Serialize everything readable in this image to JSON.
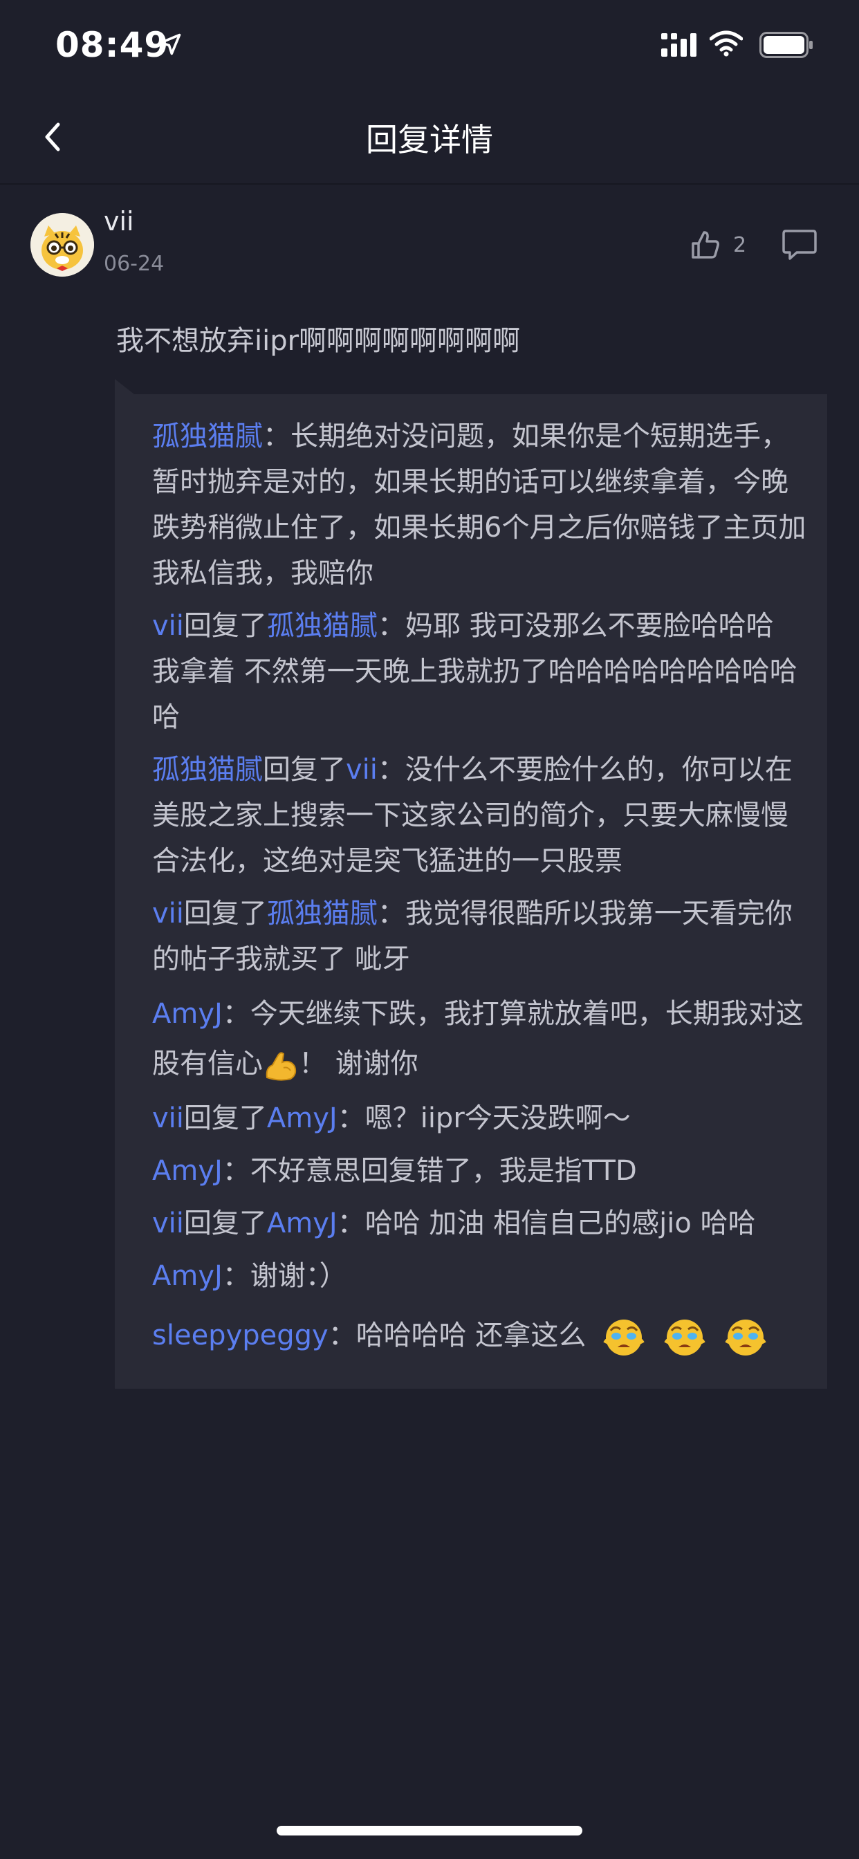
{
  "status_bar": {
    "time": "08:49"
  },
  "nav": {
    "title": "回复详情"
  },
  "comment": {
    "username": "vii",
    "date": "06-24",
    "like_count": "2",
    "text": "我不想放弃iipr啊啊啊啊啊啊啊啊"
  },
  "replies": [
    {
      "user": "孤独猫腻",
      "reply_word": "",
      "target": "",
      "sep": "：",
      "text": "长期绝对没问题，如果你是个短期选手，暂时抛弃是对的，如果长期的话可以继续拿着，今晚跌势稍微止住了，如果长期6个月之后你赔钱了主页加我私信我，我赔你"
    },
    {
      "user": "vii",
      "reply_word": "回复了",
      "target": "孤独猫腻",
      "sep": "：",
      "text": "妈耶 我可没那么不要脸哈哈哈 我拿着 不然第一天晚上我就扔了哈哈哈哈哈哈哈哈哈哈"
    },
    {
      "user": "孤独猫腻",
      "reply_word": "回复了",
      "target": "vii",
      "sep": "：",
      "text": "没什么不要脸什么的，你可以在美股之家上搜索一下这家公司的简介，只要大麻慢慢合法化，这绝对是突飞猛进的一只股票"
    },
    {
      "user": "vii",
      "reply_word": "回复了",
      "target": "孤独猫腻",
      "sep": "：",
      "text": "我觉得很酷所以我第一天看完你的帖子我就买了 呲牙"
    },
    {
      "user": "AmyJ",
      "reply_word": "",
      "target": "",
      "sep": "：",
      "text": "今天继续下跌，我打算就放着吧，长期我对这股有信心",
      "text_after": "！ 谢谢你"
    },
    {
      "user": "vii",
      "reply_word": "回复了",
      "target": "AmyJ",
      "sep": "：",
      "text": "嗯？iipr今天没跌啊～"
    },
    {
      "user": "AmyJ",
      "reply_word": "",
      "target": "",
      "sep": "：",
      "text": "不好意思回复错了，我是指TTD"
    },
    {
      "user": "vii",
      "reply_word": "回复了",
      "target": "AmyJ",
      "sep": "：",
      "text": "哈哈 加油 相信自己的感jio 哈哈"
    },
    {
      "user": "AmyJ",
      "reply_word": "",
      "target": "",
      "sep": "：",
      "text": "谢谢：）"
    },
    {
      "user": "sleepypeggy",
      "reply_word": "",
      "target": "",
      "sep": "：",
      "text": "哈哈哈哈 还拿这么"
    }
  ],
  "icons": {
    "location": "location-arrow-icon",
    "signal": "cellular-signal-icon",
    "wifi": "wifi-icon",
    "battery": "battery-icon",
    "back": "chevron-left-icon",
    "like": "thumbs-up-icon",
    "comment": "comment-bubble-icon",
    "muscle": "flexed-biceps-emoji",
    "crying_face": "crying-face-emoji"
  },
  "colors": {
    "username_link": "#5b7ef0",
    "background": "#1e1f2b",
    "panel": "#292a36"
  }
}
